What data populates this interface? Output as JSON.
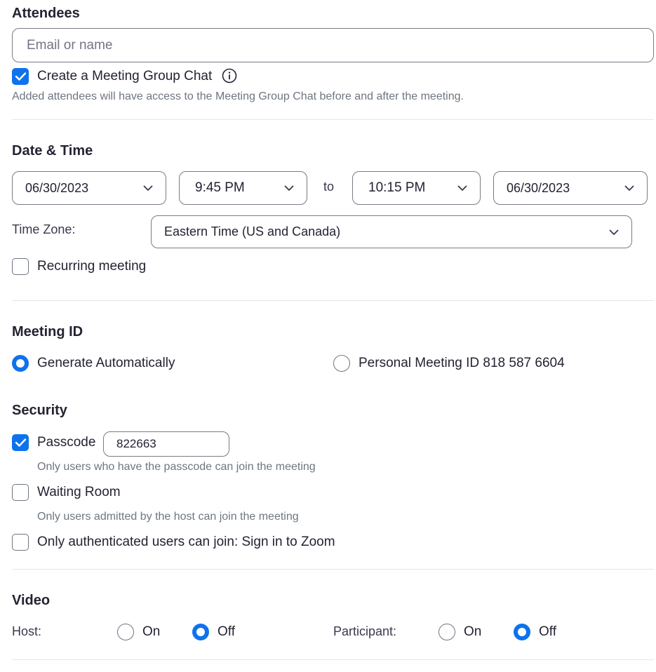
{
  "attendees": {
    "title": "Attendees",
    "input_placeholder": "Email or name",
    "group_chat_label": "Create a Meeting Group Chat",
    "group_chat_checked": true,
    "group_chat_hint": "Added attendees will have access to the Meeting Group Chat before and after the meeting."
  },
  "datetime": {
    "title": "Date & Time",
    "start_date": "06/30/2023",
    "start_time": "9:45 PM",
    "to_label": "to",
    "end_time": "10:15 PM",
    "end_date": "06/30/2023",
    "timezone_label": "Time Zone:",
    "timezone_value": "Eastern Time (US and Canada)",
    "recurring_label": "Recurring meeting",
    "recurring_checked": false
  },
  "meeting_id": {
    "title": "Meeting ID",
    "generate_label": "Generate Automatically",
    "personal_label": "Personal Meeting ID 818 587 6604",
    "selected": "generate"
  },
  "security": {
    "title": "Security",
    "passcode_label": "Passcode",
    "passcode_checked": true,
    "passcode_value": "822663",
    "passcode_hint": "Only users who have the passcode can join the meeting",
    "waiting_room_label": "Waiting Room",
    "waiting_room_checked": false,
    "waiting_room_hint": "Only users admitted by the host can join the meeting",
    "auth_label": "Only authenticated users can join: Sign in to Zoom",
    "auth_checked": false
  },
  "video": {
    "title": "Video",
    "host_label": "Host:",
    "participant_label": "Participant:",
    "on_label": "On",
    "off_label": "Off",
    "host_selected": "off",
    "participant_selected": "off"
  },
  "colors": {
    "accent": "#0e72ed",
    "text": "#232333",
    "hint": "#6e7680",
    "border": "#7a7a85",
    "divider": "#e4e4ed"
  }
}
